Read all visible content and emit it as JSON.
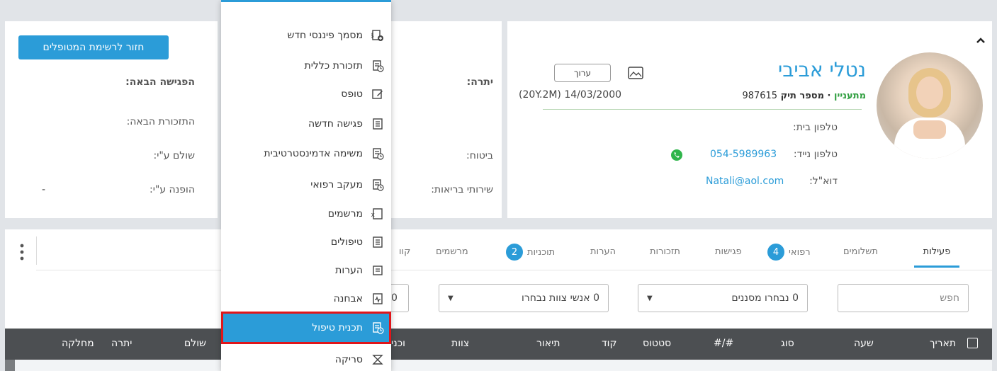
{
  "patient": {
    "name": "נטלי אביבי",
    "status": "מתעניין",
    "file_label": "· מספר תיק",
    "file_number": "987615",
    "dob": "(20Y.2M) 14/03/2000",
    "edit_label": "ערוך",
    "home_phone_label": "טלפון בית:",
    "mobile_label": "טלפון נייד:",
    "mobile_value": "054-5989963",
    "email_label": "דוא\"ל:",
    "email_value": "Natali@aol.com",
    "collapse_icon": "chevron-up-icon"
  },
  "mid": {
    "balance_label": "יתרה:",
    "insurance_label": "ביטוח:",
    "health_label": "שירותי בריאות:"
  },
  "left": {
    "back_button": "חזור לרשימת המטופלים",
    "next_meeting": "הפגישה הבאה:",
    "next_reminder": "התזכורת הבאה:",
    "paid_by": "שולם ע\"י:",
    "referred_by": "הופנה ע\"י:",
    "referred_value": "-"
  },
  "tabs": [
    {
      "label": "פעילות",
      "active": true
    },
    {
      "label": "תשלומים"
    },
    {
      "label": "רפואי",
      "badge": "4"
    },
    {
      "label": "פגישות"
    },
    {
      "label": "תזכורות"
    },
    {
      "label": "הערות"
    },
    {
      "label": "תוכניות",
      "badge": "2"
    },
    {
      "label": "מרשמים"
    },
    {
      "label": "קוו"
    }
  ],
  "filters": {
    "search_placeholder": "חפש",
    "screens": "0 נבחרו מסננים",
    "staff": "0 אנשי צוות נבחרו",
    "partial": "0"
  },
  "table_headers": [
    "תאריך",
    "שעה",
    "סוג",
    "#/#",
    "סטטוס",
    "קוד",
    "תיאור",
    "צוות",
    "תוכני",
    "שולם",
    "יתרה",
    "מחלקה"
  ],
  "menu": {
    "items": [
      {
        "label": "מסמך פיננסי חדש",
        "icon": "dollar-doc-icon"
      },
      {
        "label": "תזכורת כללית",
        "icon": "reminder-icon"
      },
      {
        "label": "טופס",
        "icon": "form-edit-icon"
      },
      {
        "label": "פגישה חדשה",
        "icon": "clipboard-icon"
      },
      {
        "label": "משימה אדמינסטרטיבית",
        "icon": "task-icon"
      },
      {
        "label": "מעקב רפואי",
        "icon": "medical-followup-icon"
      },
      {
        "label": "מרשמים",
        "icon": "prescription-icon"
      },
      {
        "label": "טיפולים",
        "icon": "treatment-icon"
      },
      {
        "label": "הערות",
        "icon": "notes-icon"
      },
      {
        "label": "אבחנה",
        "icon": "diagnosis-icon"
      },
      {
        "label": "תכנית טיפול",
        "icon": "treatment-plan-icon",
        "selected": true
      },
      {
        "label": "סריקה",
        "icon": "scan-icon"
      }
    ]
  },
  "colors": {
    "accent": "#2b9cd8",
    "status_green": "#2e9e3e",
    "highlight": "#e0161a",
    "header_dark": "#4c4f52"
  }
}
